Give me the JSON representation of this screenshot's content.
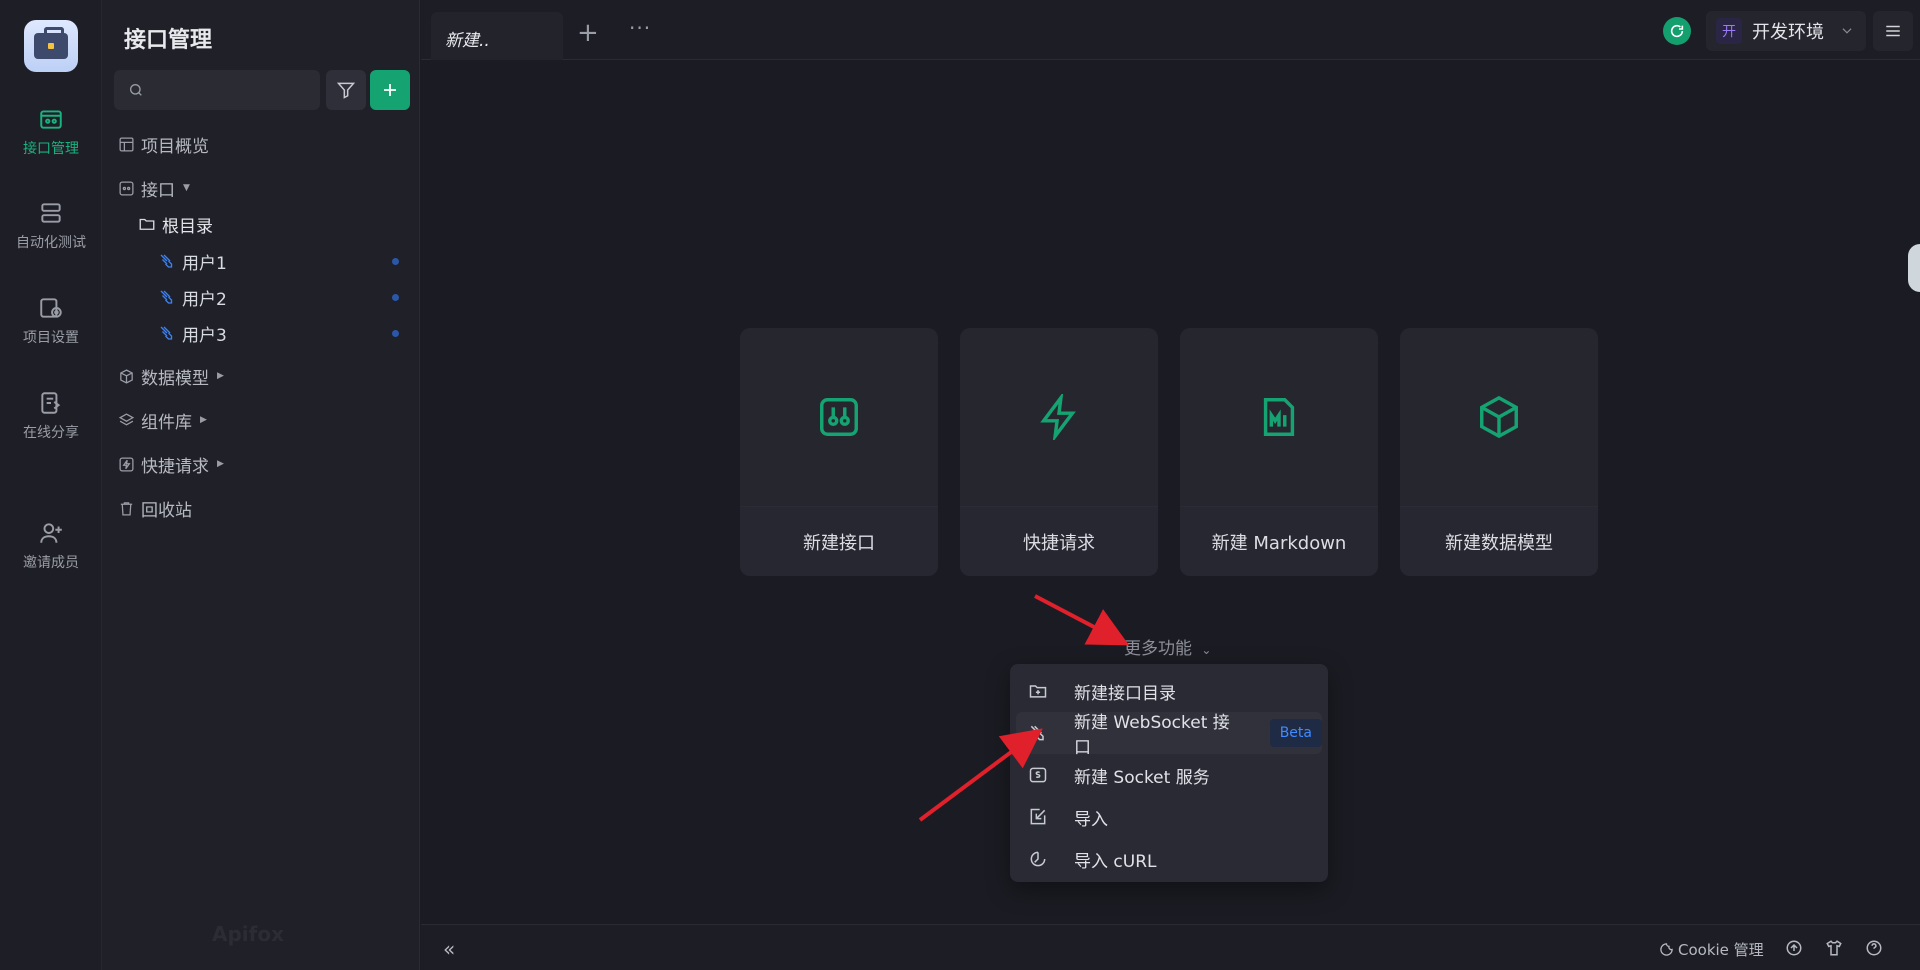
{
  "rail": {
    "items": [
      {
        "label": "接口管理",
        "icon": "api-management-icon",
        "active": true
      },
      {
        "label": "自动化测试",
        "icon": "automation-test-icon"
      },
      {
        "label": "项目设置",
        "icon": "project-settings-icon"
      },
      {
        "label": "在线分享",
        "icon": "online-share-icon"
      },
      {
        "label": "邀请成员",
        "icon": "invite-member-icon"
      }
    ]
  },
  "sidebar": {
    "title": "接口管理",
    "search_placeholder": "",
    "tree": {
      "overview": "项目概览",
      "api": "接口",
      "root": "根目录",
      "files": [
        "用户1",
        "用户2",
        "用户3"
      ],
      "schemas": "数据模型",
      "components": "组件库",
      "quick": "快捷请求",
      "trash": "回收站"
    },
    "watermark": "Apifox"
  },
  "tabs": {
    "active_tab": "新建..",
    "add": "+",
    "more": "···"
  },
  "header": {
    "env_badge": "开",
    "env_name": "开发环境"
  },
  "cards": [
    {
      "label": "新建接口",
      "icon": "api-icon"
    },
    {
      "label": "快捷请求",
      "icon": "lightning-icon"
    },
    {
      "label": "新建 Markdown",
      "icon": "markdown-icon"
    },
    {
      "label": "新建数据模型",
      "icon": "cube-icon"
    }
  ],
  "more_features": "更多功能",
  "dropdown": {
    "items": [
      {
        "label": "新建接口目录",
        "icon": "folder-add-icon"
      },
      {
        "label": "新建 WebSocket 接口",
        "icon": "websocket-icon",
        "badge": "Beta"
      },
      {
        "label": "新建 Socket 服务",
        "icon": "socket-icon"
      },
      {
        "label": "导入",
        "icon": "import-icon"
      },
      {
        "label": "导入 cURL",
        "icon": "curl-icon"
      }
    ]
  },
  "bottom": {
    "collapse": "«",
    "cookie": "Cookie 管理"
  },
  "colors": {
    "accent": "#15a372",
    "background": "#1b1c23",
    "beta_text": "#3f8bff",
    "arrow": "#e0202a"
  }
}
